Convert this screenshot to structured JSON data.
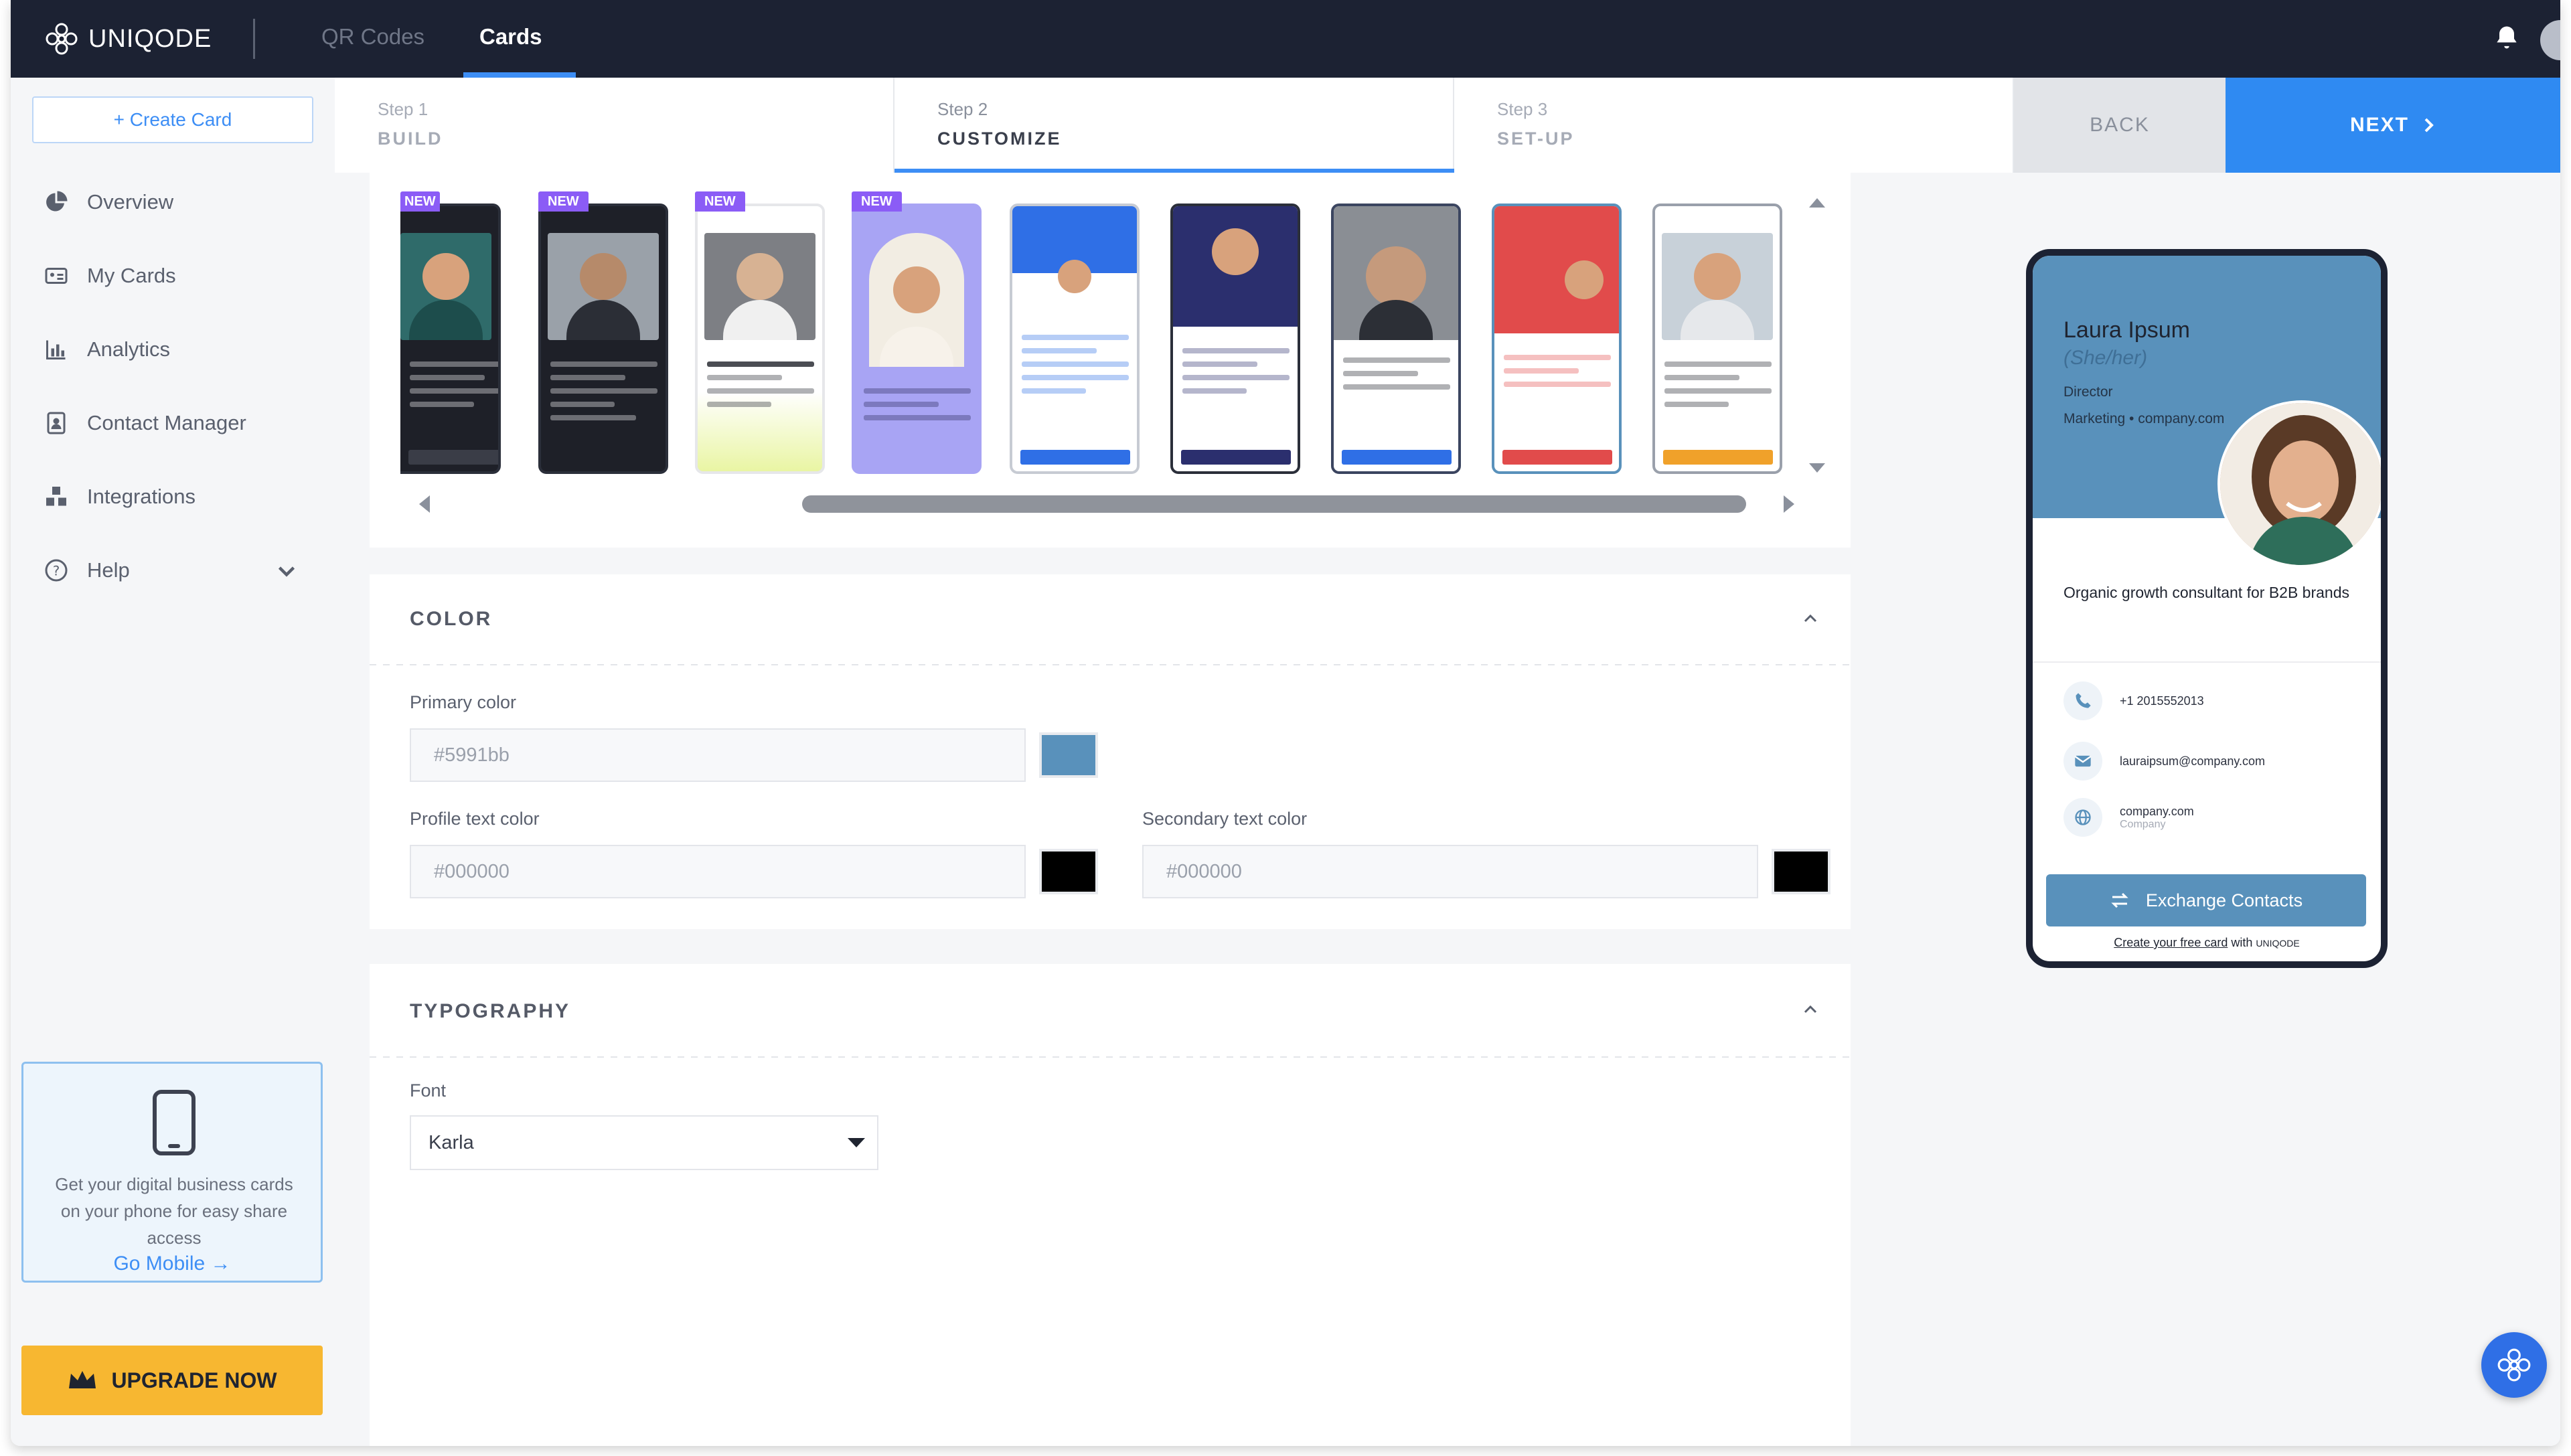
{
  "app": {
    "brand": "UNIQODE",
    "nav_tabs": [
      {
        "label": "QR Codes",
        "active": false
      },
      {
        "label": "Cards",
        "active": true
      }
    ],
    "colors": {
      "nav_bg": "#1c2233",
      "accent": "#3d8ef5",
      "upgrade": "#f7b731"
    }
  },
  "sidebar": {
    "create_label": "+ Create Card",
    "items": [
      {
        "label": "Overview",
        "icon": "pie-chart-icon"
      },
      {
        "label": "My Cards",
        "icon": "id-card-icon"
      },
      {
        "label": "Analytics",
        "icon": "bar-chart-icon"
      },
      {
        "label": "Contact Manager",
        "icon": "contact-book-icon"
      },
      {
        "label": "Integrations",
        "icon": "cubes-icon"
      },
      {
        "label": "Help",
        "icon": "question-circle-icon"
      }
    ],
    "mobile_promo": {
      "text": "Get your digital business cards on your phone for easy share access",
      "link": "Go Mobile →"
    },
    "upgrade_label": "UPGRADE NOW"
  },
  "steps": [
    {
      "num": "Step 1",
      "name": "BUILD",
      "active": false
    },
    {
      "num": "Step 2",
      "name": "CUSTOMIZE",
      "active": true
    },
    {
      "num": "Step 3",
      "name": "SET-UP",
      "active": false
    }
  ],
  "actions": {
    "back": "BACK",
    "next": "NEXT"
  },
  "templates": {
    "new_badge": "NEW",
    "items": [
      {
        "id": "t1",
        "badge": true
      },
      {
        "id": "t2",
        "badge": true
      },
      {
        "id": "t3",
        "badge": true
      },
      {
        "id": "t4",
        "badge": true
      },
      {
        "id": "t5",
        "badge": false
      },
      {
        "id": "t6",
        "badge": false
      },
      {
        "id": "t7",
        "badge": false
      },
      {
        "id": "t8",
        "badge": false,
        "selected": true
      },
      {
        "id": "t9",
        "badge": false
      }
    ]
  },
  "color_section": {
    "title": "COLOR",
    "primary_label": "Primary color",
    "primary_value": "#5991bb",
    "profile_label": "Profile text color",
    "profile_value": "#000000",
    "secondary_label": "Secondary text color",
    "secondary_value": "#000000"
  },
  "typography_section": {
    "title": "TYPOGRAPHY",
    "font_label": "Font",
    "font_value": "Karla"
  },
  "preview": {
    "name": "Laura Ipsum",
    "pronouns": "(She/her)",
    "title": "Director",
    "department": "Marketing • company.com",
    "bio": "Organic growth consultant for B2B brands",
    "phone": "+1 2015552013",
    "email": "lauraipsum@company.com",
    "website": "company.com",
    "website_sub": "Company",
    "exchange_label": "Exchange Contacts",
    "footer_link": "Create your free card",
    "footer_with": "with",
    "footer_brand": "UNIQODE"
  }
}
